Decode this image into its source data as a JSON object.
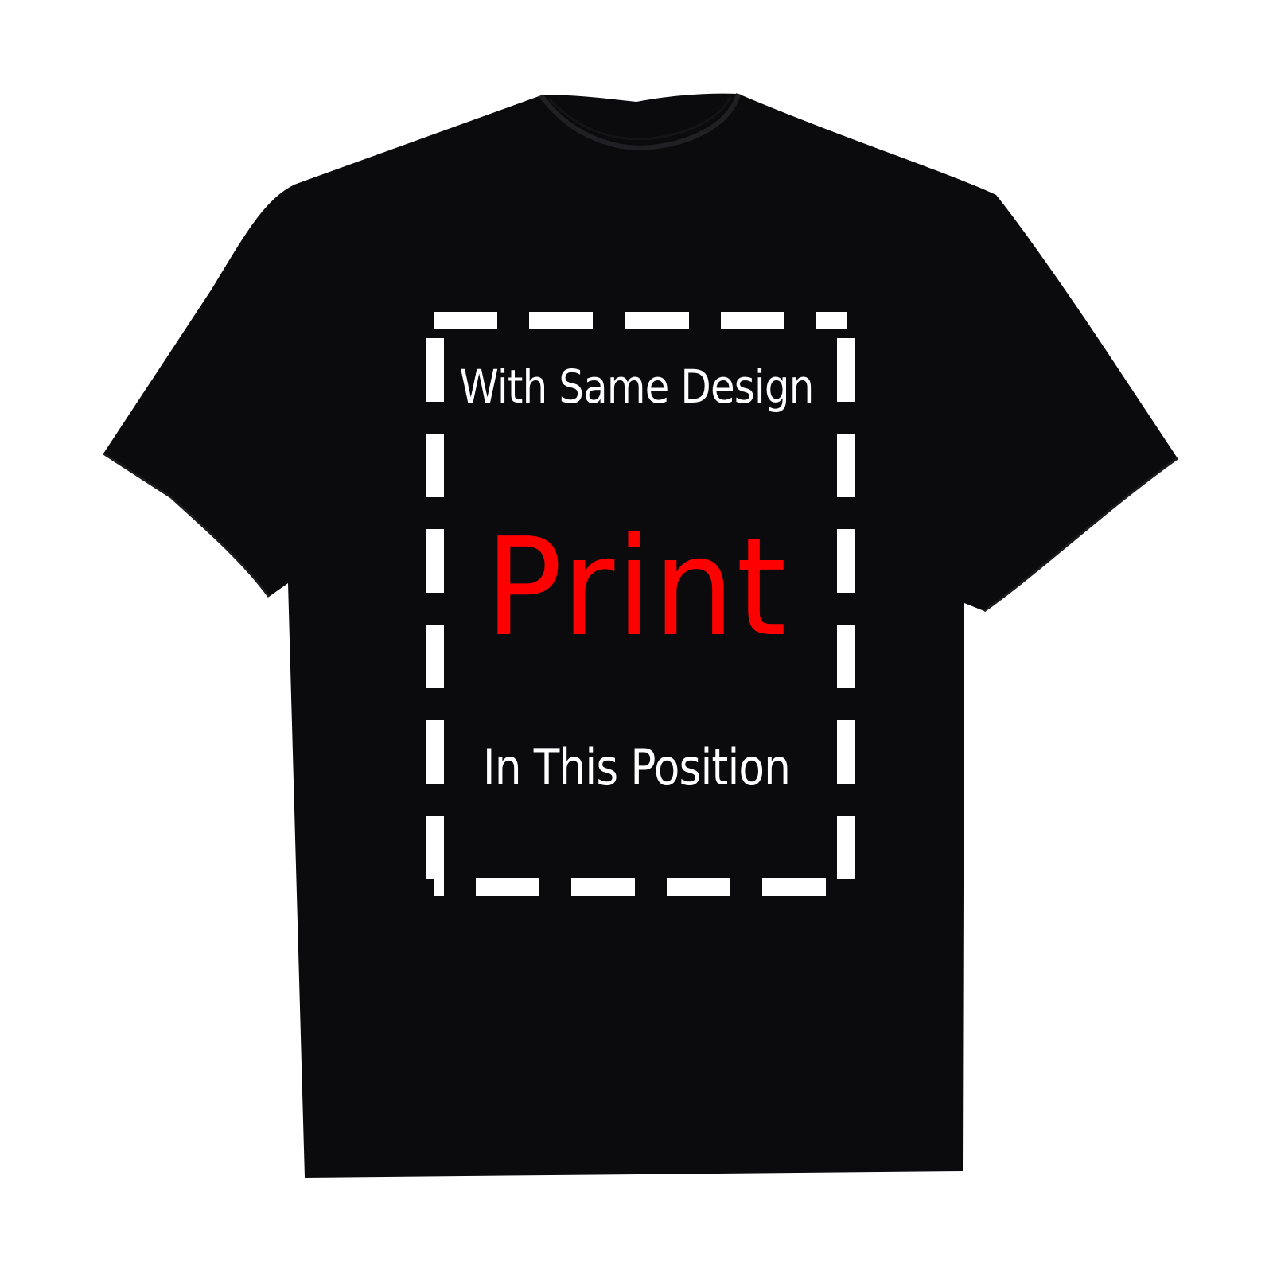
{
  "product": {
    "shirt_color": "#0b0b0d",
    "border_color": "#ffffff",
    "print_lines": {
      "top": "With Same Design",
      "main": "Print",
      "bottom": "In This Position"
    },
    "text_colors": {
      "top": "#ffffff",
      "main": "#ff0000",
      "bottom": "#ffffff"
    }
  }
}
